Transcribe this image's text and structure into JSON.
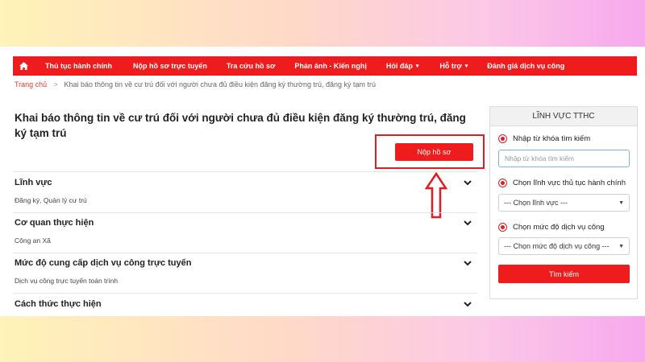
{
  "nav": {
    "home_icon": "home-icon",
    "items": [
      {
        "label": "Thủ tục hành chính"
      },
      {
        "label": "Nộp hồ sơ trực tuyến"
      },
      {
        "label": "Tra cứu hồ sơ"
      },
      {
        "label": "Phản ánh - Kiến nghị"
      },
      {
        "label": "Hỏi đáp",
        "caret": "▾"
      },
      {
        "label": "Hỗ trợ",
        "caret": "▾"
      },
      {
        "label": "Đánh giá dịch vụ công"
      }
    ]
  },
  "breadcrumb": {
    "home": "Trang chủ",
    "separator": ">",
    "current": "Khai báo thông tin về cư trú đối với người chưa đủ điều kiện đăng ký thường trú, đăng ký tạm trú"
  },
  "main": {
    "title": "Khai báo thông tin về cư trú đối với người chưa đủ điều kiện đăng ký thường trú, đăng ký tạm trú",
    "submit_label": "Nộp hồ sơ",
    "sections": [
      {
        "heading": "Lĩnh vực",
        "value": "Đăng ký, Quản lý cư trú"
      },
      {
        "heading": "Cơ quan thực hiện",
        "value": "Công an Xã"
      },
      {
        "heading": "Mức độ cung cấp dịch vụ công trực tuyến",
        "value": "Dịch vụ công trực tuyến toàn trình"
      },
      {
        "heading": "Cách thức thực hiện",
        "value": ""
      }
    ]
  },
  "sidebar": {
    "title": "LĨNH VỰC TTHC",
    "keyword_label": "Nhập từ khóa tìm kiếm",
    "keyword_placeholder": "Nhập từ khóa tìm kiếm",
    "field_label": "Chọn lĩnh vực thủ tục hành chính",
    "field_selected": "--- Chọn lĩnh vực ---",
    "level_label": "Chọn mức độ dịch vụ công",
    "level_selected": "--- Chọn mức độ dịch vụ công ---",
    "search_label": "Tìm kiếm"
  },
  "colors": {
    "brand_red": "#ee1c1c",
    "annotation_red": "#e31b23"
  }
}
